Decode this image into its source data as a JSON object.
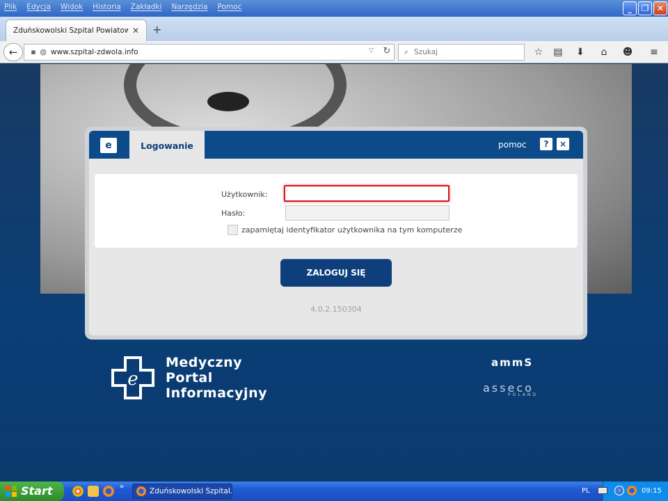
{
  "browser": {
    "menu": [
      "Plik",
      "Edycja",
      "Widok",
      "Historia",
      "Zakładki",
      "Narzędzia",
      "Pomoc"
    ],
    "tab_title": "Zduńskowolski Szpital Powiatowy ...",
    "url": "www.szpital-zdwola.info",
    "search_placeholder": "Szukaj"
  },
  "dialog": {
    "tab_label": "Logowanie",
    "help_label": "pomoc",
    "help_button": "?",
    "close_button": "×",
    "username_label": "Użytkownik:",
    "password_label": "Hasło:",
    "username_value": "",
    "password_value": "",
    "remember_label": "zapamiętaj identyfikator użytkownika na tym komputerze",
    "remember_checked": false,
    "login_button": "ZALOGUJ SIĘ",
    "version": "4.0.2.150304"
  },
  "branding": {
    "portal_lines": [
      "Medyczny",
      "Portal",
      "Informacyjny"
    ],
    "amms": "ammS",
    "asseco": "asseco",
    "asseco_sub": "POLAND"
  },
  "taskbar": {
    "start_label": "Start",
    "task_label": "Zduńskowolski Szpital...",
    "language": "PL",
    "clock": "09:15"
  },
  "colors": {
    "header_blue": "#0d4a8a",
    "error_red": "#d9141c",
    "page_bg": "#0b3a6e"
  }
}
